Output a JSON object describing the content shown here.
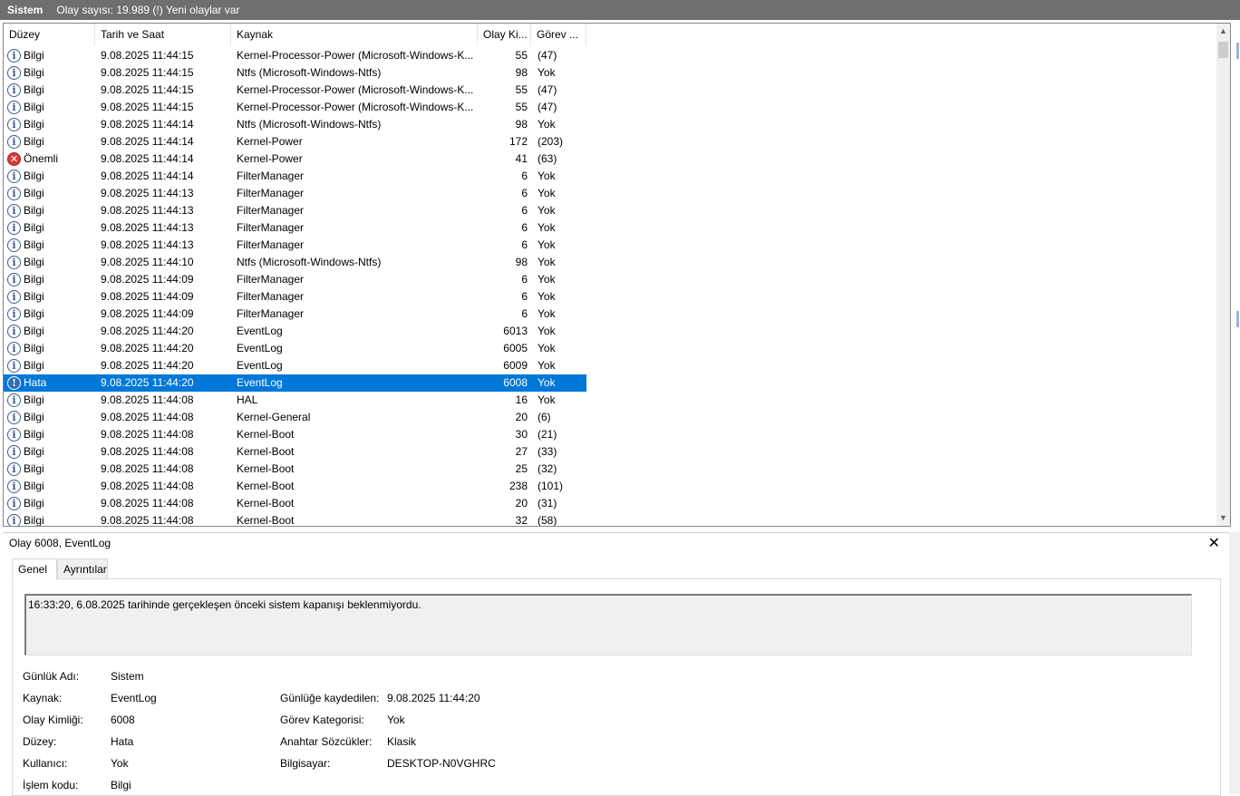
{
  "titlebar": {
    "title": "Sistem",
    "info": "Olay sayısı: 19.989 (!) Yeni olaylar var"
  },
  "columns": {
    "level": "Düzey",
    "datetime": "Tarih ve Saat",
    "source": "Kaynak",
    "event_id": "Olay Ki...",
    "task": "Görev ..."
  },
  "rows": [
    {
      "level": "Bilgi",
      "icon": "info-icon",
      "datetime": "9.08.2025 11:44:15",
      "source": "Kernel-Processor-Power (Microsoft-Windows-K...",
      "event_id": "55",
      "task": "(47)"
    },
    {
      "level": "Bilgi",
      "icon": "info-icon",
      "datetime": "9.08.2025 11:44:15",
      "source": "Ntfs (Microsoft-Windows-Ntfs)",
      "event_id": "98",
      "task": "Yok"
    },
    {
      "level": "Bilgi",
      "icon": "info-icon",
      "datetime": "9.08.2025 11:44:15",
      "source": "Kernel-Processor-Power (Microsoft-Windows-K...",
      "event_id": "55",
      "task": "(47)"
    },
    {
      "level": "Bilgi",
      "icon": "info-icon",
      "datetime": "9.08.2025 11:44:15",
      "source": "Kernel-Processor-Power (Microsoft-Windows-K...",
      "event_id": "55",
      "task": "(47)"
    },
    {
      "level": "Bilgi",
      "icon": "info-icon",
      "datetime": "9.08.2025 11:44:14",
      "source": "Ntfs (Microsoft-Windows-Ntfs)",
      "event_id": "98",
      "task": "Yok"
    },
    {
      "level": "Bilgi",
      "icon": "info-icon",
      "datetime": "9.08.2025 11:44:14",
      "source": "Kernel-Power",
      "event_id": "172",
      "task": "(203)"
    },
    {
      "level": "Önemli",
      "icon": "critical-icon",
      "datetime": "9.08.2025 11:44:14",
      "source": "Kernel-Power",
      "event_id": "41",
      "task": "(63)"
    },
    {
      "level": "Bilgi",
      "icon": "info-icon",
      "datetime": "9.08.2025 11:44:14",
      "source": "FilterManager",
      "event_id": "6",
      "task": "Yok"
    },
    {
      "level": "Bilgi",
      "icon": "info-icon",
      "datetime": "9.08.2025 11:44:13",
      "source": "FilterManager",
      "event_id": "6",
      "task": "Yok"
    },
    {
      "level": "Bilgi",
      "icon": "info-icon",
      "datetime": "9.08.2025 11:44:13",
      "source": "FilterManager",
      "event_id": "6",
      "task": "Yok"
    },
    {
      "level": "Bilgi",
      "icon": "info-icon",
      "datetime": "9.08.2025 11:44:13",
      "source": "FilterManager",
      "event_id": "6",
      "task": "Yok"
    },
    {
      "level": "Bilgi",
      "icon": "info-icon",
      "datetime": "9.08.2025 11:44:13",
      "source": "FilterManager",
      "event_id": "6",
      "task": "Yok"
    },
    {
      "level": "Bilgi",
      "icon": "info-icon",
      "datetime": "9.08.2025 11:44:10",
      "source": "Ntfs (Microsoft-Windows-Ntfs)",
      "event_id": "98",
      "task": "Yok"
    },
    {
      "level": "Bilgi",
      "icon": "info-icon",
      "datetime": "9.08.2025 11:44:09",
      "source": "FilterManager",
      "event_id": "6",
      "task": "Yok"
    },
    {
      "level": "Bilgi",
      "icon": "info-icon",
      "datetime": "9.08.2025 11:44:09",
      "source": "FilterManager",
      "event_id": "6",
      "task": "Yok"
    },
    {
      "level": "Bilgi",
      "icon": "info-icon",
      "datetime": "9.08.2025 11:44:09",
      "source": "FilterManager",
      "event_id": "6",
      "task": "Yok"
    },
    {
      "level": "Bilgi",
      "icon": "info-icon",
      "datetime": "9.08.2025 11:44:20",
      "source": "EventLog",
      "event_id": "6013",
      "task": "Yok"
    },
    {
      "level": "Bilgi",
      "icon": "info-icon",
      "datetime": "9.08.2025 11:44:20",
      "source": "EventLog",
      "event_id": "6005",
      "task": "Yok"
    },
    {
      "level": "Bilgi",
      "icon": "info-icon",
      "datetime": "9.08.2025 11:44:20",
      "source": "EventLog",
      "event_id": "6009",
      "task": "Yok"
    },
    {
      "level": "Hata",
      "icon": "error-icon",
      "datetime": "9.08.2025 11:44:20",
      "source": "EventLog",
      "event_id": "6008",
      "task": "Yok",
      "selected": true
    },
    {
      "level": "Bilgi",
      "icon": "info-icon",
      "datetime": "9.08.2025 11:44:08",
      "source": "HAL",
      "event_id": "16",
      "task": "Yok"
    },
    {
      "level": "Bilgi",
      "icon": "info-icon",
      "datetime": "9.08.2025 11:44:08",
      "source": "Kernel-General",
      "event_id": "20",
      "task": "(6)"
    },
    {
      "level": "Bilgi",
      "icon": "info-icon",
      "datetime": "9.08.2025 11:44:08",
      "source": "Kernel-Boot",
      "event_id": "30",
      "task": "(21)"
    },
    {
      "level": "Bilgi",
      "icon": "info-icon",
      "datetime": "9.08.2025 11:44:08",
      "source": "Kernel-Boot",
      "event_id": "27",
      "task": "(33)"
    },
    {
      "level": "Bilgi",
      "icon": "info-icon",
      "datetime": "9.08.2025 11:44:08",
      "source": "Kernel-Boot",
      "event_id": "25",
      "task": "(32)"
    },
    {
      "level": "Bilgi",
      "icon": "info-icon",
      "datetime": "9.08.2025 11:44:08",
      "source": "Kernel-Boot",
      "event_id": "238",
      "task": "(101)"
    },
    {
      "level": "Bilgi",
      "icon": "info-icon",
      "datetime": "9.08.2025 11:44:08",
      "source": "Kernel-Boot",
      "event_id": "20",
      "task": "(31)"
    },
    {
      "level": "Bilgi",
      "icon": "info-icon",
      "datetime": "9.08.2025 11:44:08",
      "source": "Kernel-Boot",
      "event_id": "32",
      "task": "(58)"
    }
  ],
  "detail": {
    "title": "Olay 6008, EventLog",
    "close_icon": "close-icon",
    "tabs": {
      "general": "Genel",
      "details": "Ayrıntılar"
    },
    "message": "16:33:20, 6.08.2025 tarihinde gerçekleşen önceki sistem kapanışı beklenmiyordu.",
    "props": {
      "log_name_label": "Günlük Adı:",
      "log_name": "Sistem",
      "source_label": "Kaynak:",
      "source": "EventLog",
      "logged_label": "Günlüğe kaydedilen:",
      "logged": "9.08.2025 11:44:20",
      "event_id_label": "Olay Kimliği:",
      "event_id": "6008",
      "task_cat_label": "Görev Kategorisi:",
      "task_cat": "Yok",
      "level_label": "Düzey:",
      "level": "Hata",
      "keywords_label": "Anahtar Sözcükler:",
      "keywords": "Klasik",
      "user_label": "Kullanıcı:",
      "user": "Yok",
      "computer_label": "Bilgisayar:",
      "computer": "DESKTOP-N0VGHRC",
      "opcode_label": "İşlem kodu:",
      "opcode": "Bilgi"
    }
  },
  "colors": {
    "selection": "#0078d7",
    "titlebar": "#6f6f6f",
    "critical": "#d83b3b",
    "error": "#2d6db5"
  }
}
